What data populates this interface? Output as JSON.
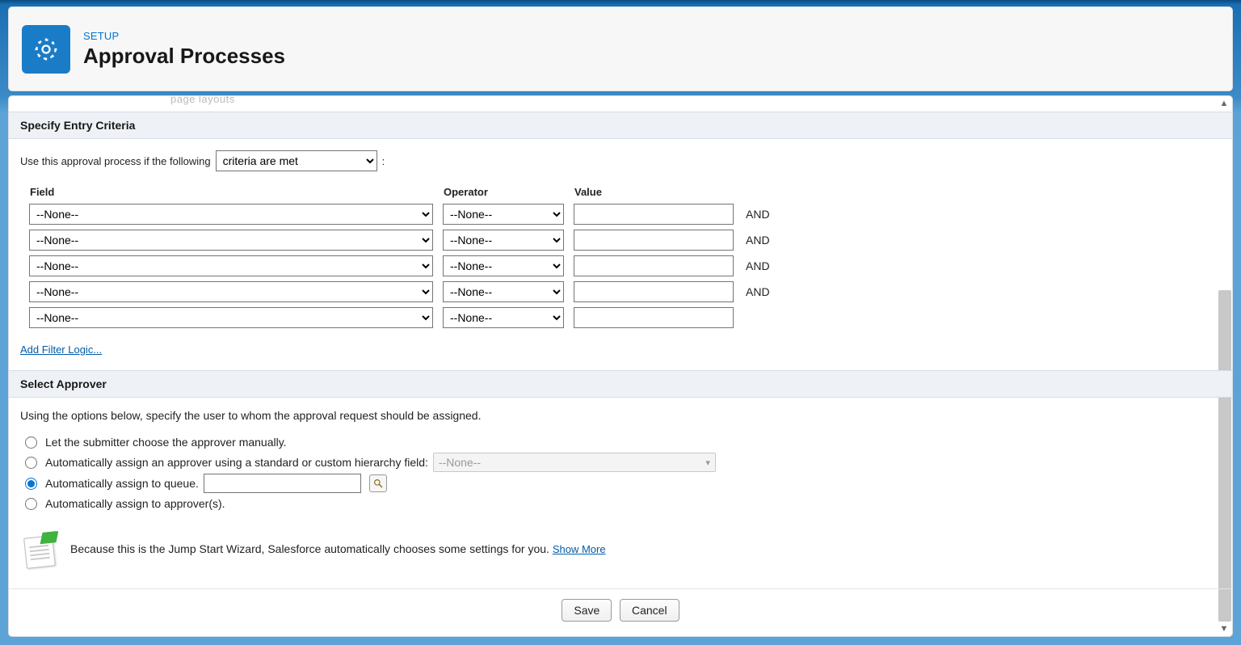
{
  "header": {
    "pretitle": "SETUP",
    "title": "Approval Processes"
  },
  "peek_text": "page layouts",
  "sections": {
    "criteria": {
      "title": "Specify Entry Criteria",
      "intro_prefix": "Use this approval process if the following",
      "intro_suffix": ":",
      "condition_select": "criteria are met",
      "columns": {
        "field": "Field",
        "operator": "Operator",
        "value": "Value"
      },
      "none_option": "--None--",
      "and_label": "AND",
      "rows": 5,
      "filter_link": "Add Filter Logic..."
    },
    "approver": {
      "title": "Select Approver",
      "intro": "Using the options below, specify the user to whom the approval request should be assigned.",
      "options": {
        "manual": "Let the submitter choose the approver manually.",
        "hierarchy": "Automatically assign an approver using a standard or custom hierarchy field:",
        "hierarchy_placeholder": "--None--",
        "queue": "Automatically assign to queue.",
        "approvers": "Automatically assign to approver(s)."
      },
      "selected": "queue",
      "wizard_note_prefix": "Because this is the Jump Start Wizard, Salesforce automatically chooses some settings for you. ",
      "wizard_note_link": "Show More"
    }
  },
  "footer": {
    "save": "Save",
    "cancel": "Cancel"
  }
}
